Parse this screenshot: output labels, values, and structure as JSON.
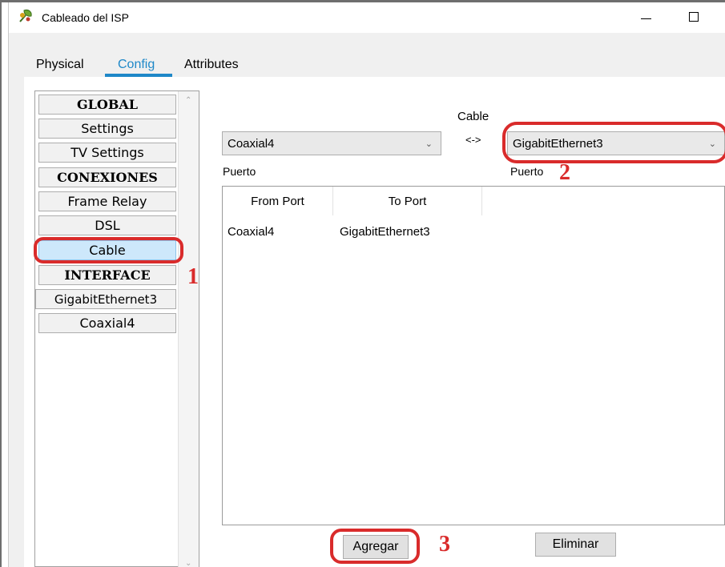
{
  "window": {
    "title": "Cableado del ISP"
  },
  "tabs": [
    {
      "label": "Physical"
    },
    {
      "label": "Config"
    },
    {
      "label": "Attributes"
    }
  ],
  "sidebar": {
    "items": [
      {
        "label": "GLOBAL"
      },
      {
        "label": "Settings"
      },
      {
        "label": "TV Settings"
      },
      {
        "label": "CONEXIONES"
      },
      {
        "label": "Frame Relay"
      },
      {
        "label": "DSL"
      },
      {
        "label": "Cable"
      },
      {
        "label": "INTERFACE"
      },
      {
        "label": "GigabitEthernet3"
      },
      {
        "label": "Coaxial4"
      }
    ]
  },
  "connection": {
    "cable_label": "Cable",
    "arrow": "<->",
    "left_select": "Coaxial4",
    "right_select": "GigabitEthernet3",
    "left_port_label": "Puerto",
    "right_port_label": "Puerto"
  },
  "table": {
    "headers": [
      "From Port",
      "To Port"
    ],
    "rows": [
      {
        "from": "Coaxial4",
        "to": "GigabitEthernet3"
      }
    ]
  },
  "buttons": {
    "add": "Agregar",
    "remove": "Eliminar"
  },
  "annotations": [
    "1",
    "2",
    "3"
  ],
  "colors": {
    "accent": "#1e88c8",
    "annotation": "#d92b2b",
    "selected": "#cde8fb"
  }
}
